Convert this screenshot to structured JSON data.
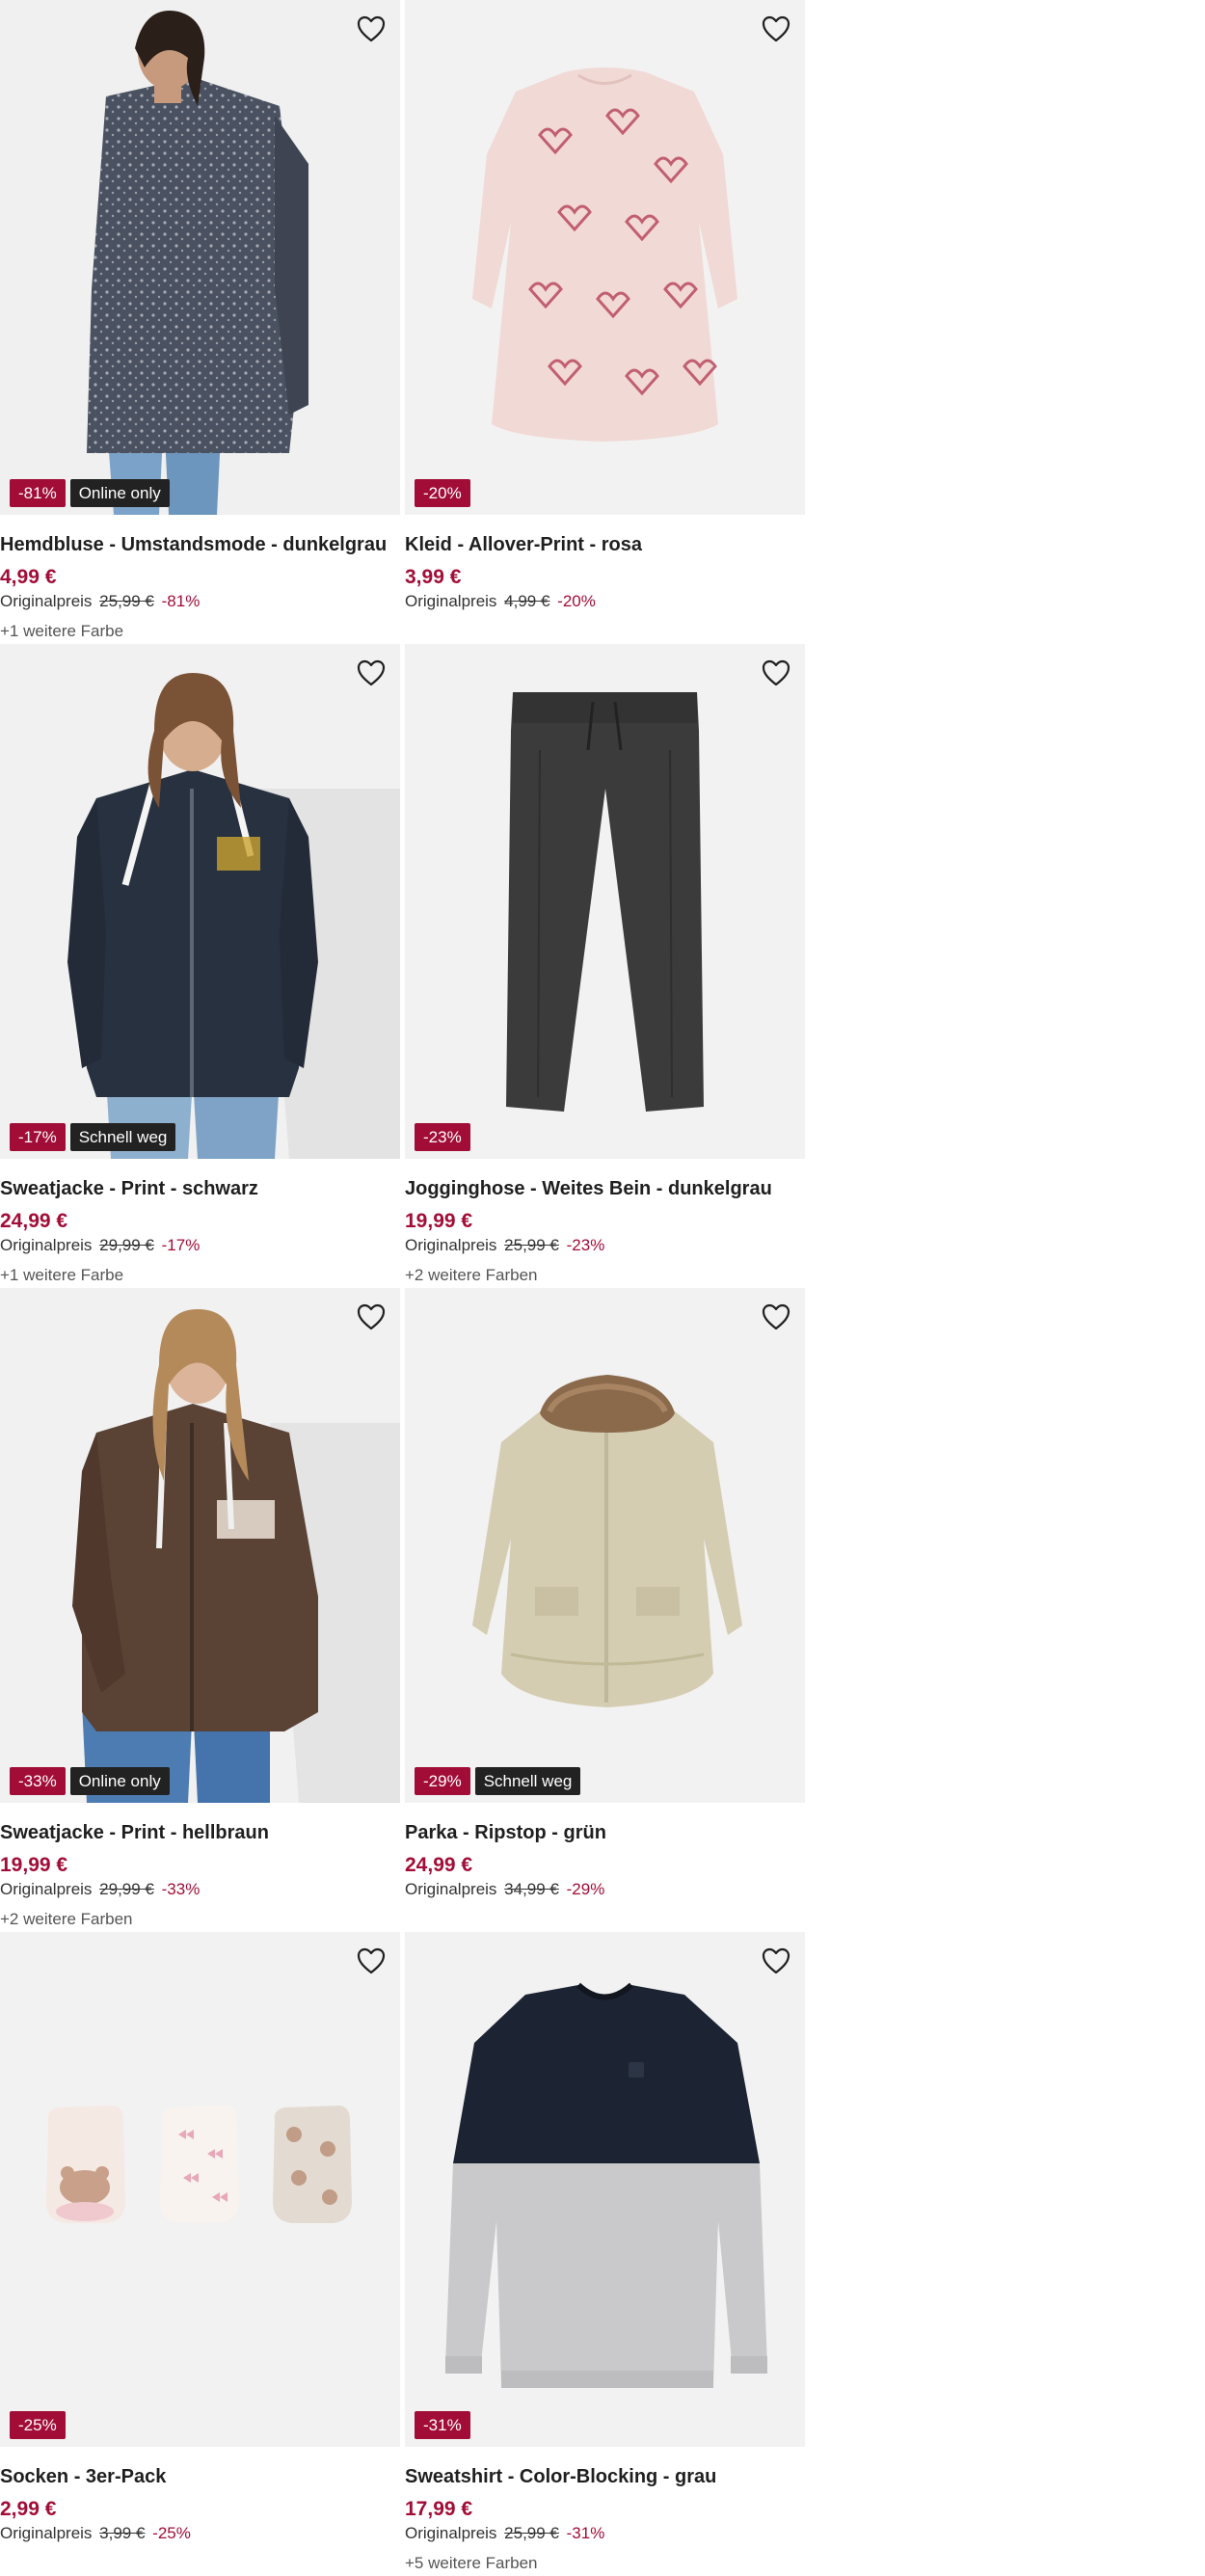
{
  "products": [
    {
      "title": "Hemdbluse - Umstandsmode - dunkelgrau",
      "price": "4,99 €",
      "original_label": "Originalpreis",
      "original_price": "25,99 €",
      "discount_text": "-81%",
      "badge_discount": "-81%",
      "badge_tag": "Online only",
      "more_colors": "+1 weitere Farbe",
      "image": "person-grey-blouse-jeans"
    },
    {
      "title": "Kleid - Allover-Print - rosa",
      "price": "3,99 €",
      "original_label": "Originalpreis",
      "original_price": "4,99 €",
      "discount_text": "-20%",
      "badge_discount": "-20%",
      "badge_tag": "",
      "more_colors": "",
      "image": "pink-dress-hearts"
    },
    {
      "title": "Sweatjacke - Print - schwarz",
      "price": "24,99 €",
      "original_label": "Originalpreis",
      "original_price": "29,99 €",
      "discount_text": "-17%",
      "badge_discount": "-17%",
      "badge_tag": "Schnell weg",
      "more_colors": "+1 weitere Farbe",
      "image": "person-navy-hoodie"
    },
    {
      "title": "Jogginghose - Weites Bein - dunkelgrau",
      "price": "19,99 €",
      "original_label": "Originalpreis",
      "original_price": "25,99 €",
      "discount_text": "-23%",
      "badge_discount": "-23%",
      "badge_tag": "",
      "more_colors": "+2 weitere Farben",
      "image": "dark-grey-joggers"
    },
    {
      "title": "Sweatjacke - Print - hellbraun",
      "price": "19,99 €",
      "original_label": "Originalpreis",
      "original_price": "29,99 €",
      "discount_text": "-33%",
      "badge_discount": "-33%",
      "badge_tag": "Online only",
      "more_colors": "+2 weitere Farben",
      "image": "person-brown-hoodie"
    },
    {
      "title": "Parka - Ripstop - grün",
      "price": "24,99 €",
      "original_label": "Originalpreis",
      "original_price": "34,99 €",
      "discount_text": "-29%",
      "badge_discount": "-29%",
      "badge_tag": "Schnell weg",
      "more_colors": "",
      "image": "beige-parka-fur-hood"
    },
    {
      "title": "Socken - 3er-Pack",
      "price": "2,99 €",
      "original_label": "Originalpreis",
      "original_price": "3,99 €",
      "discount_text": "-25%",
      "badge_discount": "-25%",
      "badge_tag": "",
      "more_colors": "",
      "image": "three-sock-pairs"
    },
    {
      "title": "Sweatshirt - Color-Blocking - grau",
      "price": "17,99 €",
      "original_label": "Originalpreis",
      "original_price": "25,99 €",
      "discount_text": "-31%",
      "badge_discount": "-31%",
      "badge_tag": "",
      "more_colors": "+5 weitere Farben",
      "image": "navy-grey-sweatshirt"
    }
  ],
  "colors": {
    "discount": "#a10d37",
    "tag": "#222222",
    "image_bg": "#f2f2f2"
  },
  "icons": {
    "favorite": "heart-outline-icon"
  }
}
